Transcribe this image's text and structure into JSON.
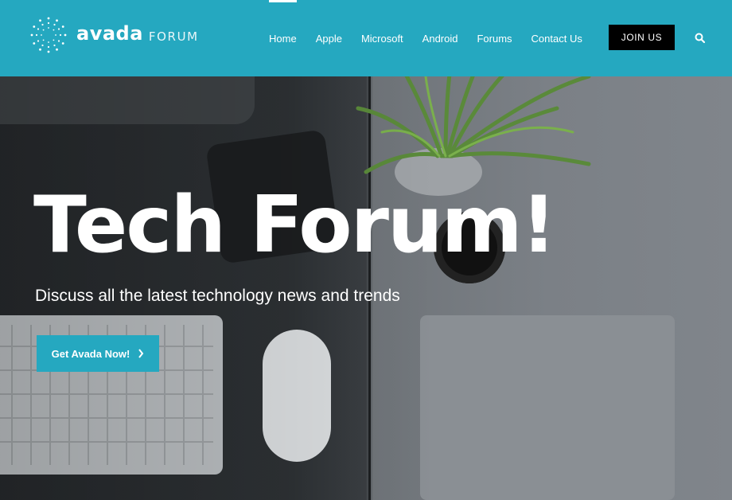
{
  "brand": {
    "name": "avada",
    "sub": "FORUM"
  },
  "nav": {
    "items": [
      {
        "label": "Home"
      },
      {
        "label": "Apple"
      },
      {
        "label": "Microsoft"
      },
      {
        "label": "Android"
      },
      {
        "label": "Forums"
      },
      {
        "label": "Contact Us"
      }
    ],
    "join_label": "JOIN US",
    "search_icon": "search-icon"
  },
  "hero": {
    "title": "Tech Forum!",
    "subtitle": "Discuss all the latest technology news and trends",
    "cta_label": "Get Avada Now!",
    "cta_icon": "chevron-right-icon"
  },
  "colors": {
    "accent": "#25a8c0",
    "dark": "#000000"
  }
}
